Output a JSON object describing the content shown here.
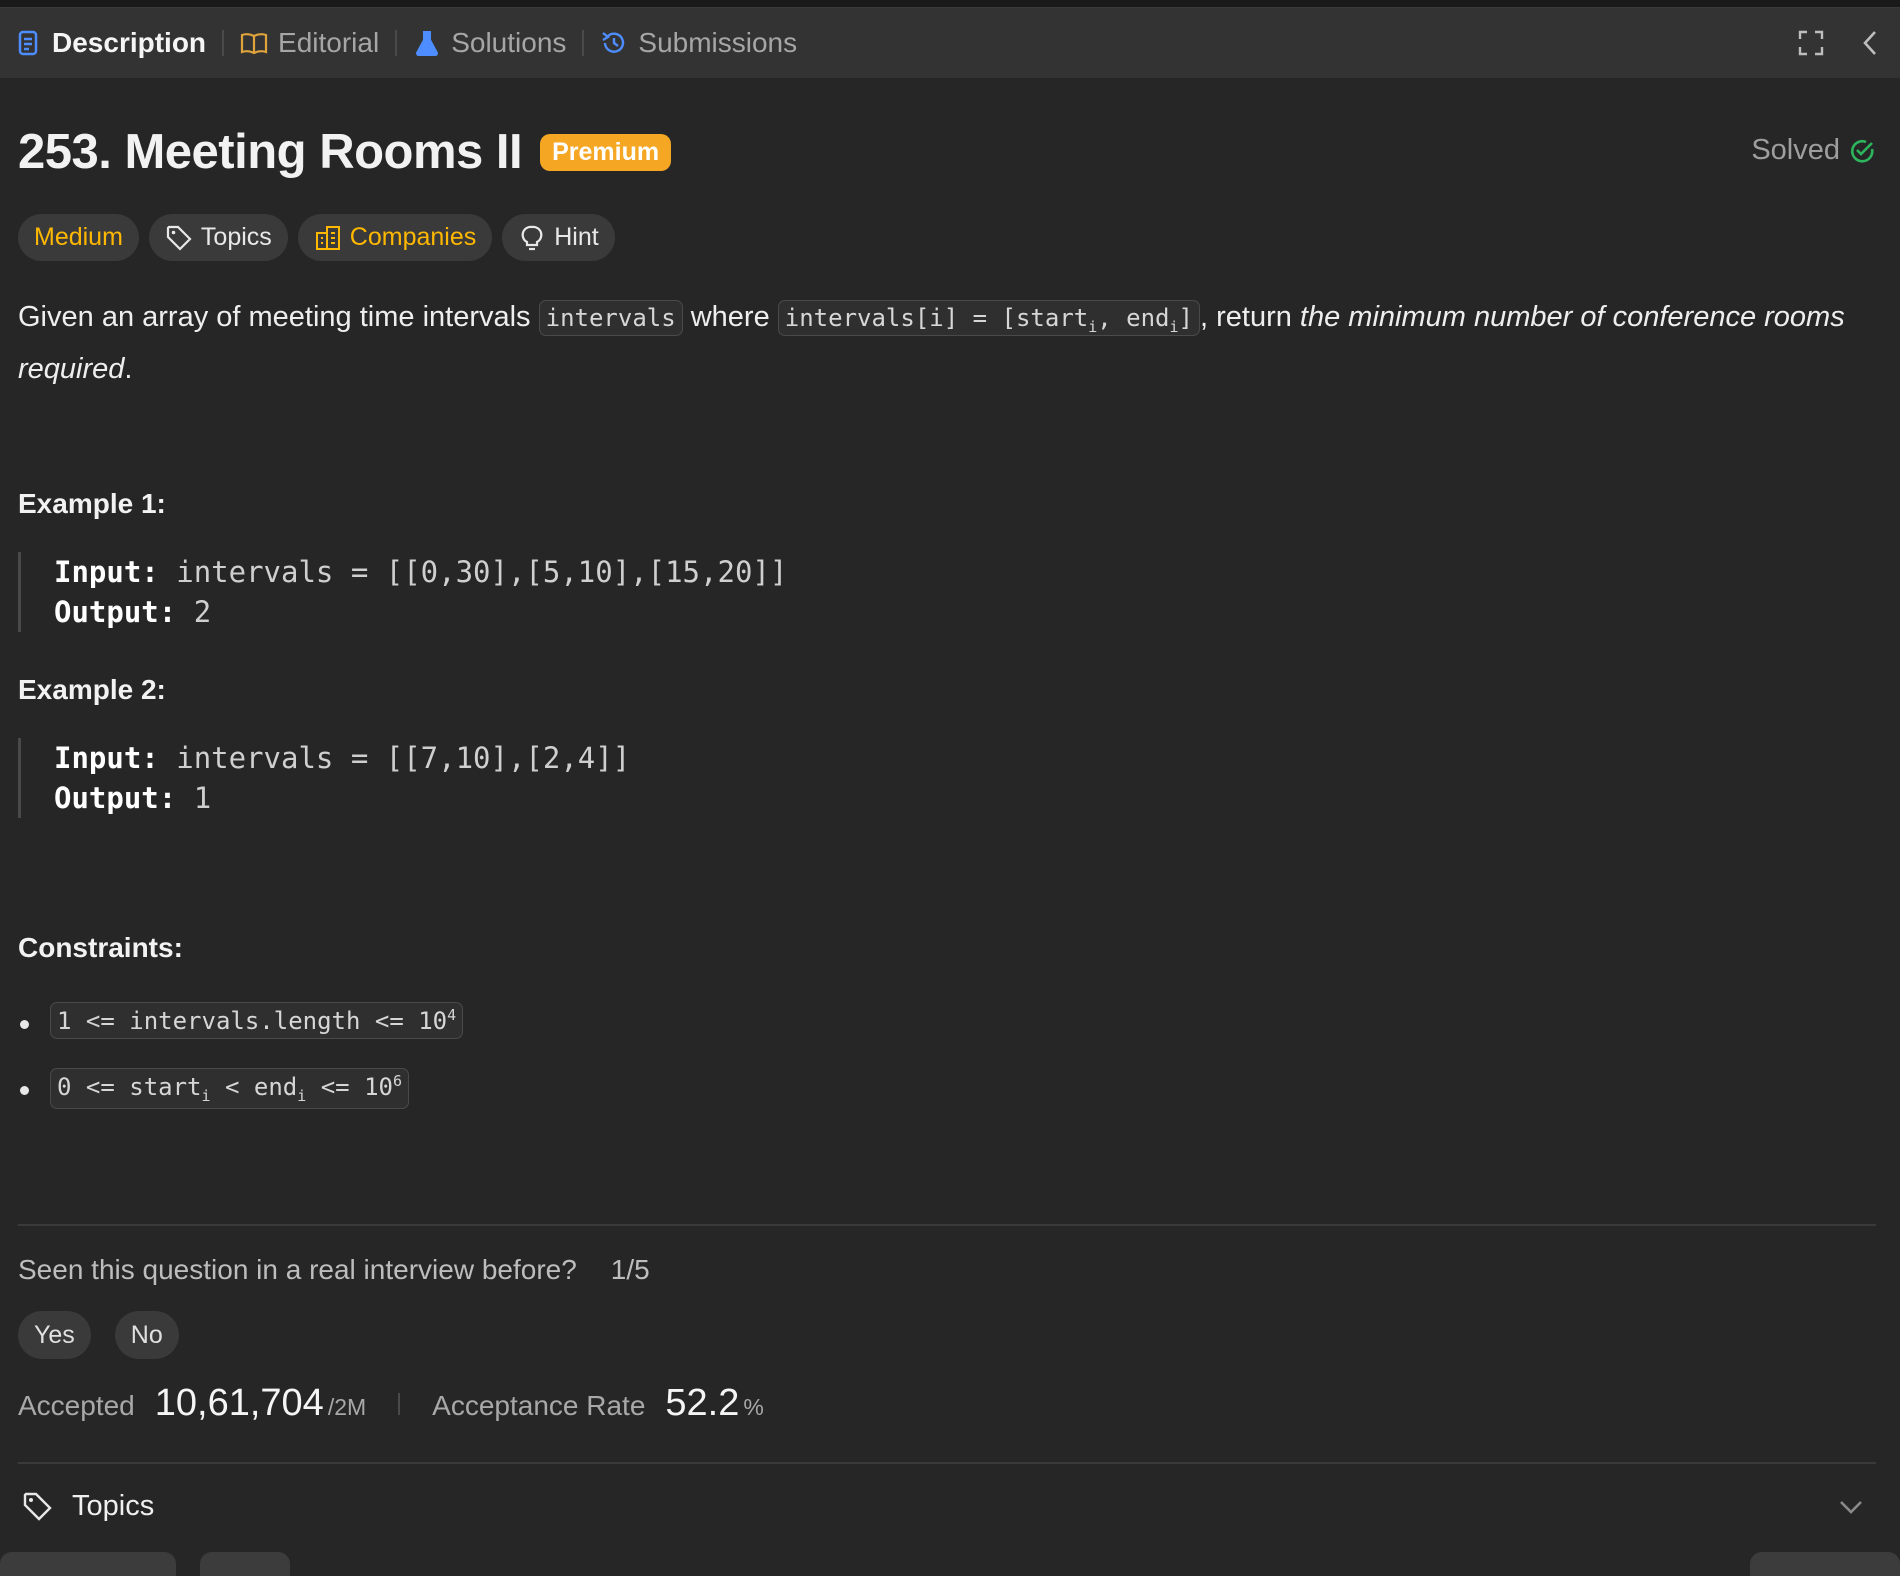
{
  "tabs": [
    {
      "label": "Description",
      "icon": "description-icon",
      "active": true
    },
    {
      "label": "Editorial",
      "icon": "book-icon"
    },
    {
      "label": "Solutions",
      "icon": "flask-icon"
    },
    {
      "label": "Submissions",
      "icon": "history-icon"
    }
  ],
  "problem": {
    "title": "253. Meeting Rooms II",
    "badge": "Premium",
    "status": "Solved",
    "chips": {
      "difficulty": "Medium",
      "topics": "Topics",
      "companies": "Companies",
      "hint": "Hint"
    },
    "description": {
      "part1": "Given an array of meeting time intervals ",
      "code1": "intervals",
      "part2": " where ",
      "code2_pre": "intervals[i] = [start",
      "code2_sub1": "i",
      "code2_mid": ", end",
      "code2_sub2": "i",
      "code2_post": "]",
      "part3": ", return ",
      "emphasis": "the minimum number of conference rooms required",
      "part4": "."
    },
    "examples": [
      {
        "title": "Example 1:",
        "input_label": "Input:",
        "input": "intervals = [[0,30],[5,10],[15,20]]",
        "output_label": "Output:",
        "output": "2"
      },
      {
        "title": "Example 2:",
        "input_label": "Input:",
        "input": "intervals = [[7,10],[2,4]]",
        "output_label": "Output:",
        "output": "1"
      }
    ],
    "constraints_title": "Constraints:",
    "constraints": {
      "c1_text": "1 <= intervals.length <= 10",
      "c1_sup": "4",
      "c2_a": "0 <= start",
      "c2_sub1": "i",
      "c2_b": " < end",
      "c2_sub2": "i",
      "c2_c": " <= 10",
      "c2_sup": "6"
    }
  },
  "interview": {
    "question": "Seen this question in a real interview before?",
    "count": "1/5",
    "yes": "Yes",
    "no": "No"
  },
  "stats": {
    "accepted_label": "Accepted",
    "accepted": "10,61,704",
    "total": "/2M",
    "rate_label": "Acceptance Rate",
    "rate": "52.2",
    "rate_unit": "%"
  },
  "topics_section": {
    "label": "Topics"
  },
  "colors": {
    "background": "#262626",
    "tabbar": "#333333",
    "premium": "#f5a623",
    "medium": "#ffb800",
    "solved_check": "#2db55d"
  }
}
